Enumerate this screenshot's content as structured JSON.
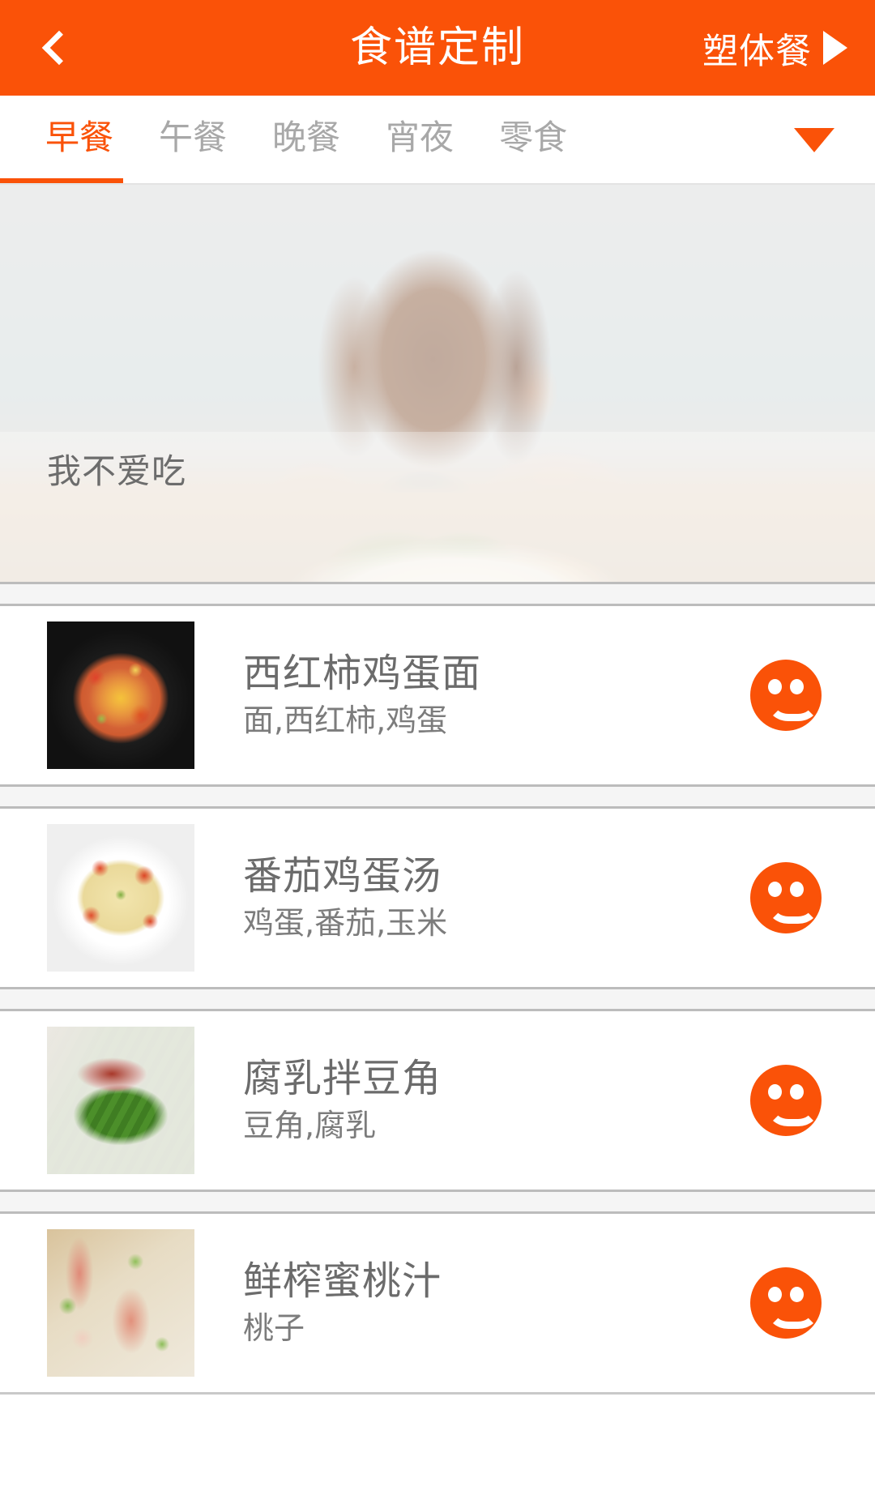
{
  "header": {
    "back_icon": "chevron-left-icon",
    "title": "食谱定制",
    "right_label": "塑体餐",
    "right_icon": "triangle-right-icon",
    "background_color": "#fa5208"
  },
  "tabs": {
    "items": [
      {
        "label": "早餐",
        "active": true
      },
      {
        "label": "午餐",
        "active": false
      },
      {
        "label": "晚餐",
        "active": false
      },
      {
        "label": "宵夜",
        "active": false
      },
      {
        "label": "零食",
        "active": false
      }
    ],
    "expand_icon": "triangle-down-icon",
    "active_color": "#fa5208",
    "inactive_color": "#a8a8a8"
  },
  "banner": {
    "caption": "我不爱吃",
    "image_alt": "girl-at-table-with-vegetable-plate"
  },
  "food_list": [
    {
      "name": "西红柿鸡蛋面",
      "ingredients": "面,西红柿,鸡蛋",
      "thumb": "tomato-egg-noodles-photo",
      "action_icon": "smiley-face-icon"
    },
    {
      "name": "番茄鸡蛋汤",
      "ingredients": "鸡蛋,番茄,玉米",
      "thumb": "tomato-egg-soup-photo",
      "action_icon": "smiley-face-icon"
    },
    {
      "name": "腐乳拌豆角",
      "ingredients": "豆角,腐乳",
      "thumb": "fermented-tofu-green-beans-photo",
      "action_icon": "smiley-face-icon"
    },
    {
      "name": "鲜榨蜜桃汁",
      "ingredients": "桃子",
      "thumb": "fresh-peach-juice-photo",
      "action_icon": "smiley-face-icon"
    }
  ],
  "colors": {
    "accent": "#fa5208",
    "text_primary": "#6b6b6b",
    "text_secondary": "#7c7c7c",
    "separator": "#bcbcbc"
  }
}
